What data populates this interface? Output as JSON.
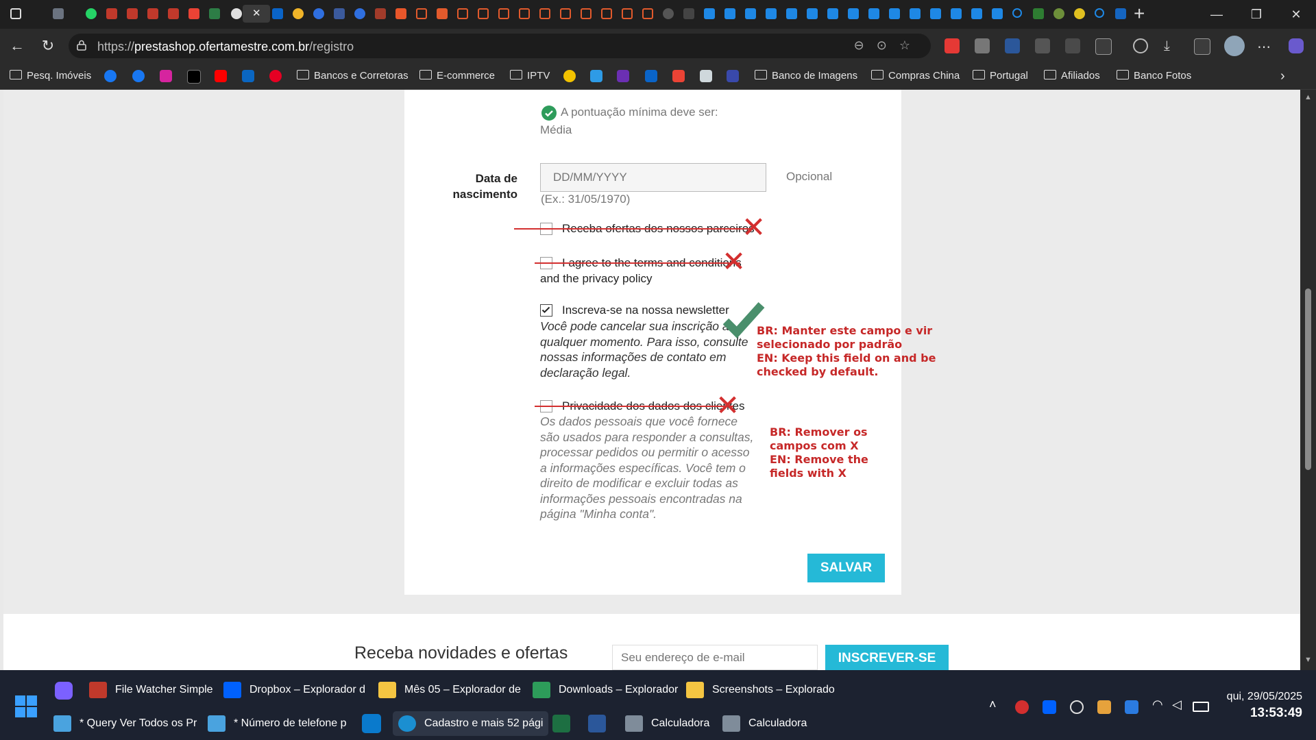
{
  "browser": {
    "url_prefix": "https://",
    "url_host": "prestashop.ofertamestre.com.br",
    "url_path": "/registro",
    "tab_close": "✕",
    "new_tab": "+"
  },
  "bookmarks": [
    {
      "label": "Pesq. Imóveis"
    },
    {
      "label": "Bancos e Corretoras"
    },
    {
      "label": "E-commerce"
    },
    {
      "label": "IPTV"
    },
    {
      "label": "Banco de Imagens"
    },
    {
      "label": "Compras China"
    },
    {
      "label": "Portugal"
    },
    {
      "label": "Afiliados"
    },
    {
      "label": "Banco Fotos"
    }
  ],
  "form": {
    "password_hint": "A pontuação mínima deve ser:",
    "password_level": "Média",
    "birthdate_label_line1": "Data de",
    "birthdate_label_line2": "nascimento",
    "birthdate_placeholder": "DD/MM/YYYY",
    "birthdate_optional": "Opcional",
    "birthdate_example": "(Ex.: 31/05/1970)",
    "partners_label": "Receba ofertas dos nossos parceiros",
    "terms_label_line1": "I agree to the terms and conditions",
    "terms_label_line2": "and the privacy policy",
    "newsletter_label": "Inscreva-se na nossa newsletter",
    "newsletter_desc": [
      "Você pode cancelar sua inscrição a",
      "qualquer momento. Para isso, consulte",
      "nossas informações de contato em",
      "declaração legal."
    ],
    "privacy_label": "Privacidade dos dados dos clientes",
    "privacy_desc": [
      "Os dados pessoais que você fornece",
      "são usados para responder a consultas,",
      "processar pedidos ou permitir o acesso",
      "a informações específicas. Você tem o",
      "direito de modificar e excluir todas as",
      "informações pessoais encontradas na",
      "página \"Minha conta\"."
    ],
    "save_button": "SALVAR"
  },
  "annotations": {
    "keep_note": [
      "BR: Manter este campo e vir",
      "selecionado por padrão",
      "EN: Keep this field on and be",
      "checked by default."
    ],
    "remove_note": [
      "BR: Remover os",
      "campos com X",
      "EN: Remove the",
      "fields with X"
    ],
    "x_mark": "✕",
    "check_mark": "✔"
  },
  "footer": {
    "newsletter_title": "Receba novidades e ofertas",
    "email_placeholder": "Seu endereço de e-mail",
    "subscribe_button": "INSCREVER-SE"
  },
  "taskbar": {
    "row1": [
      "File Watcher Simple",
      "Dropbox – Explorador d",
      "Mês 05 – Explorador de",
      "Downloads – Explorador",
      "Screenshots – Explorado"
    ],
    "row2": [
      "* Query Ver Todos os Pr",
      "* Número de telefone p",
      "Cadastro e mais 52 pági",
      "Calculadora",
      "Calculadora"
    ],
    "date": "qui, 29/05/2025",
    "time": "13:53:49"
  },
  "colors": {
    "accent": "#25b9d7",
    "annotation_red": "#d32f2f",
    "annotation_green": "#4a8f6c",
    "success_green": "#2e9c5b"
  }
}
